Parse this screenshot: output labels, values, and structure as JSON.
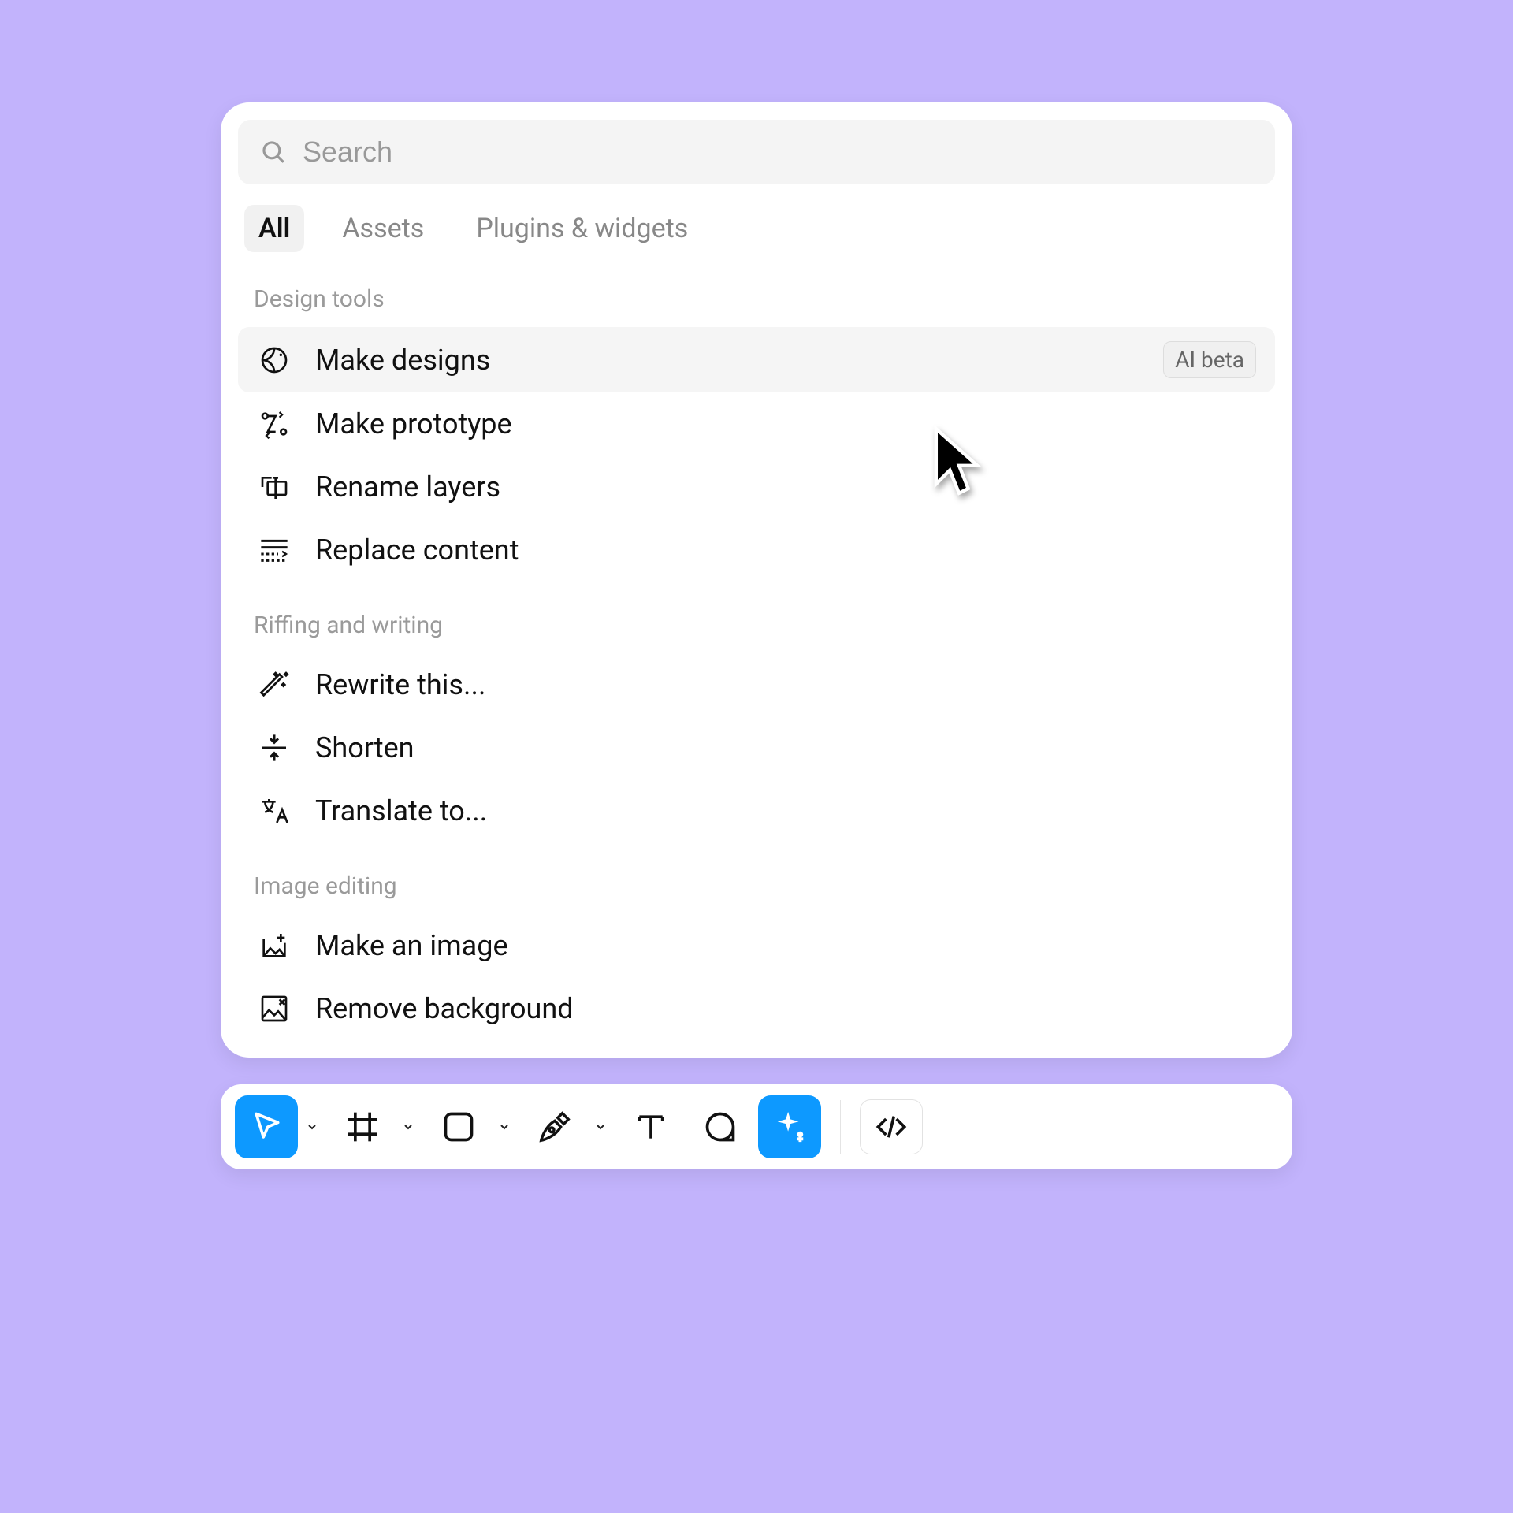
{
  "search": {
    "placeholder": "Search",
    "value": ""
  },
  "tabs": [
    {
      "label": "All",
      "active": true
    },
    {
      "label": "Assets",
      "active": false
    },
    {
      "label": "Plugins & widgets",
      "active": false
    }
  ],
  "sections": [
    {
      "title": "Design tools",
      "items": [
        {
          "icon": "sparkle-cursor-icon",
          "label": "Make designs",
          "badge": "AI beta",
          "highlighted": true
        },
        {
          "icon": "prototype-flow-icon",
          "label": "Make prototype"
        },
        {
          "icon": "rename-layers-icon",
          "label": "Rename layers"
        },
        {
          "icon": "replace-content-icon",
          "label": "Replace content"
        }
      ]
    },
    {
      "title": "Riffing and writing",
      "items": [
        {
          "icon": "magic-wand-icon",
          "label": "Rewrite this..."
        },
        {
          "icon": "shorten-icon",
          "label": "Shorten"
        },
        {
          "icon": "translate-icon",
          "label": "Translate to..."
        }
      ]
    },
    {
      "title": "Image editing",
      "items": [
        {
          "icon": "make-image-icon",
          "label": "Make an image"
        },
        {
          "icon": "remove-bg-icon",
          "label": "Remove background"
        }
      ]
    }
  ],
  "toolbar": {
    "tools": [
      {
        "name": "move-tool",
        "icon": "cursor-icon",
        "active": true,
        "chevron": true
      },
      {
        "name": "frame-tool",
        "icon": "frame-icon",
        "active": false,
        "chevron": true
      },
      {
        "name": "shape-tool",
        "icon": "rectangle-icon",
        "active": false,
        "chevron": true
      },
      {
        "name": "pen-tool",
        "icon": "pen-icon",
        "active": false,
        "chevron": true
      },
      {
        "name": "text-tool",
        "icon": "text-icon",
        "active": false,
        "chevron": false
      },
      {
        "name": "comment-tool",
        "icon": "chat-icon",
        "active": false,
        "chevron": false
      },
      {
        "name": "ai-tool",
        "icon": "sparkle-icon",
        "active": true,
        "chevron": false
      }
    ],
    "dev_mode": {
      "icon": "code-icon"
    }
  }
}
